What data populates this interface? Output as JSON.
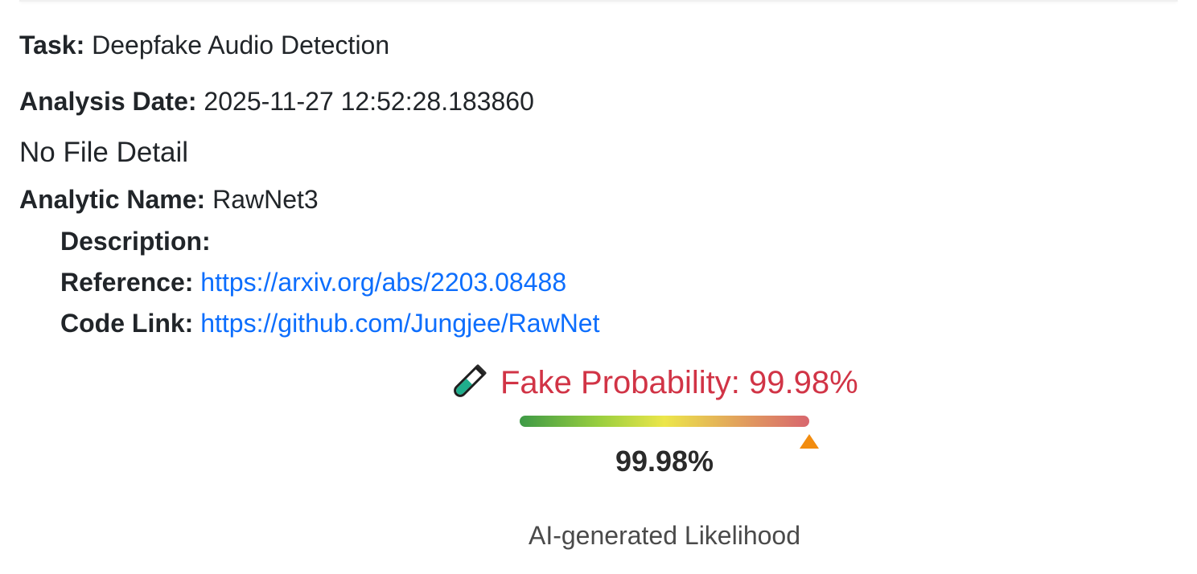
{
  "info": {
    "task_label": "Task:",
    "task_value": "Deepfake Audio Detection",
    "date_label": "Analysis Date:",
    "date_value": "2025-11-27 12:52:28.183860",
    "file_detail": "No File Detail",
    "analytic_label": "Analytic Name:",
    "analytic_value": "RawNet3",
    "description_label": "Description:",
    "description_value": "",
    "reference_label": "Reference:",
    "reference_url": "https://arxiv.org/abs/2203.08488",
    "code_label": "Code Link:",
    "code_url": "https://github.com/Jungjee/RawNet"
  },
  "result": {
    "icon": "test-tube-icon",
    "title": "Fake Probability: 99.98%",
    "probability": 0.9998,
    "value_text": "99.98%",
    "caption": "AI-generated Likelihood",
    "colors": {
      "title": "#d13446",
      "marker": "#f28c0f",
      "gauge_low": "#3e9a46",
      "gauge_mid": "#ece64a",
      "gauge_high": "#d8666e"
    }
  }
}
